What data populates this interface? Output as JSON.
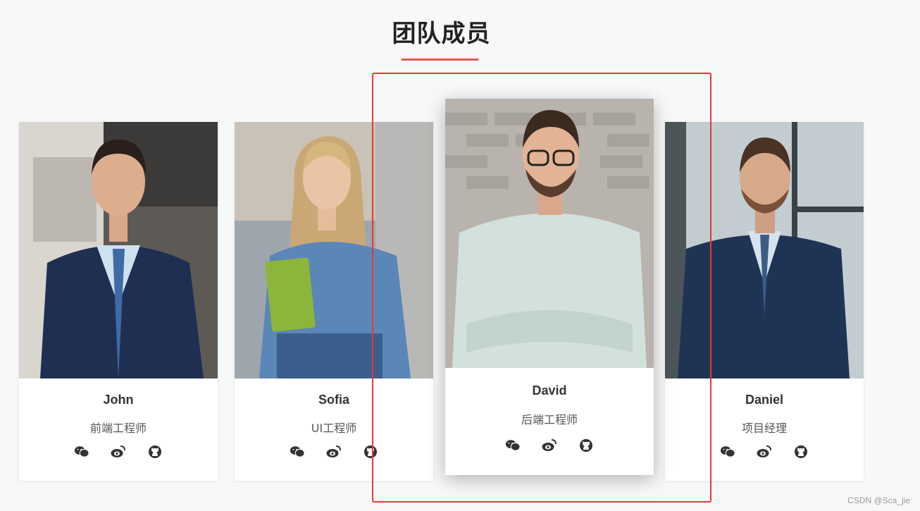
{
  "section": {
    "title": "团队成员",
    "accent_color": "#e8564b"
  },
  "members": [
    {
      "name": "John",
      "role": "前端工程师",
      "socials": [
        "wechat-icon",
        "weibo-icon",
        "github-icon"
      ]
    },
    {
      "name": "Sofia",
      "role": "UI工程师",
      "socials": [
        "wechat-icon",
        "weibo-icon",
        "github-icon"
      ]
    },
    {
      "name": "David",
      "role": "后端工程师",
      "socials": [
        "wechat-icon",
        "weibo-icon",
        "github-icon"
      ],
      "featured": true
    },
    {
      "name": "Daniel",
      "role": "项目经理",
      "socials": [
        "wechat-icon",
        "weibo-icon",
        "github-icon"
      ]
    }
  ],
  "highlight_color": "#e53935",
  "watermark": "CSDN @Sca_jie"
}
